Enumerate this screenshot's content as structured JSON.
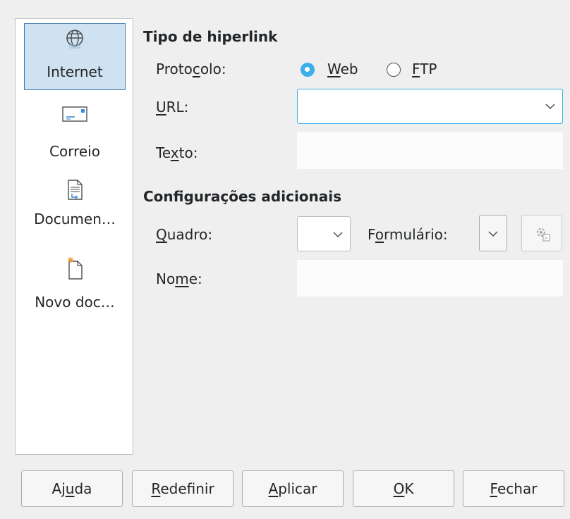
{
  "sidebar": {
    "items": [
      {
        "label": "Internet",
        "icon": "globe-icon",
        "selected": true
      },
      {
        "label": "Correio",
        "icon": "mail-icon",
        "selected": false
      },
      {
        "label": "Documen…",
        "icon": "document-icon",
        "selected": false
      },
      {
        "label": "Novo doc…",
        "icon": "new-document-icon",
        "selected": false
      }
    ]
  },
  "hyperlink_type": {
    "title": "Tipo de hiperlink",
    "protocol_label_pre": "Proto",
    "protocol_label_key": "c",
    "protocol_label_post": "olo:",
    "web_key": "W",
    "web_rest": "eb",
    "ftp_key": "F",
    "ftp_rest": "TP",
    "selected_protocol": "Web",
    "url_key": "U",
    "url_rest": "RL:",
    "url_value": "",
    "text_pre": "Te",
    "text_key": "x",
    "text_post": "to:",
    "text_value": ""
  },
  "additional": {
    "title": "Configurações adicionais",
    "frame_key": "Q",
    "frame_rest": "uadro:",
    "form_pre": "F",
    "form_key": "o",
    "form_post": "rmulário:",
    "name_pre": "No",
    "name_key": "m",
    "name_post": "e:",
    "name_value": ""
  },
  "buttons": {
    "help_pre": "Aj",
    "help_key": "u",
    "help_post": "da",
    "reset_key": "R",
    "reset_rest": "edefinir",
    "apply_key": "A",
    "apply_rest": "plicar",
    "ok_key": "O",
    "ok_rest": "K",
    "close_key": "F",
    "close_rest": "echar"
  },
  "colors": {
    "accent": "#3daee9",
    "selection_bg": "#cfe2f1",
    "selection_border": "#3b75ad"
  }
}
